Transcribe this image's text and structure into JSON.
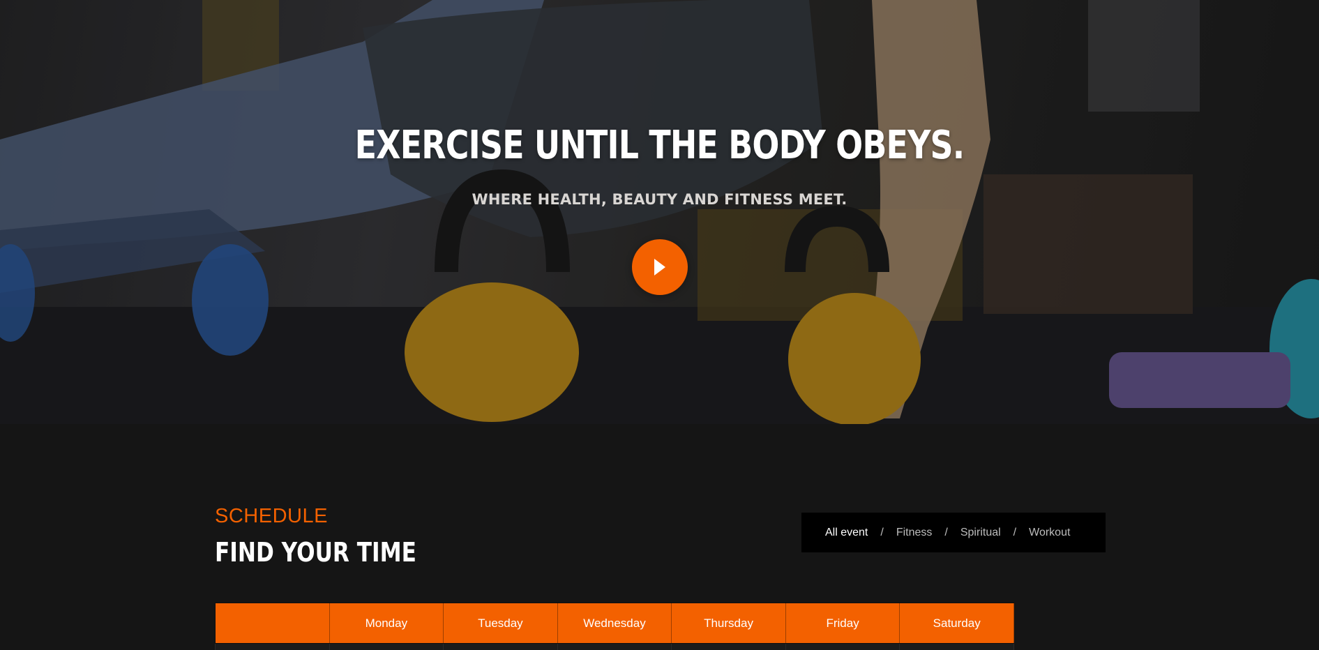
{
  "hero": {
    "title": "EXERCISE UNTIL THE BODY OBEYS.",
    "subtitle": "WHERE HEALTH, BEAUTY AND FITNESS MEET.",
    "play_icon": "play-icon"
  },
  "schedule": {
    "kicker": "SCHEDULE",
    "title": "FIND YOUR TIME",
    "filters": [
      {
        "label": "All event",
        "active": true
      },
      {
        "label": "Fitness",
        "active": false
      },
      {
        "label": "Spiritual",
        "active": false
      },
      {
        "label": "Workout",
        "active": false
      }
    ],
    "filter_separator": "/",
    "table": {
      "headers": [
        "",
        "Monday",
        "Tuesday",
        "Wednesday",
        "Thursday",
        "Friday",
        "Saturday"
      ]
    }
  },
  "colors": {
    "accent": "#f36100",
    "background": "#151515",
    "filter_bar": "#000000"
  }
}
